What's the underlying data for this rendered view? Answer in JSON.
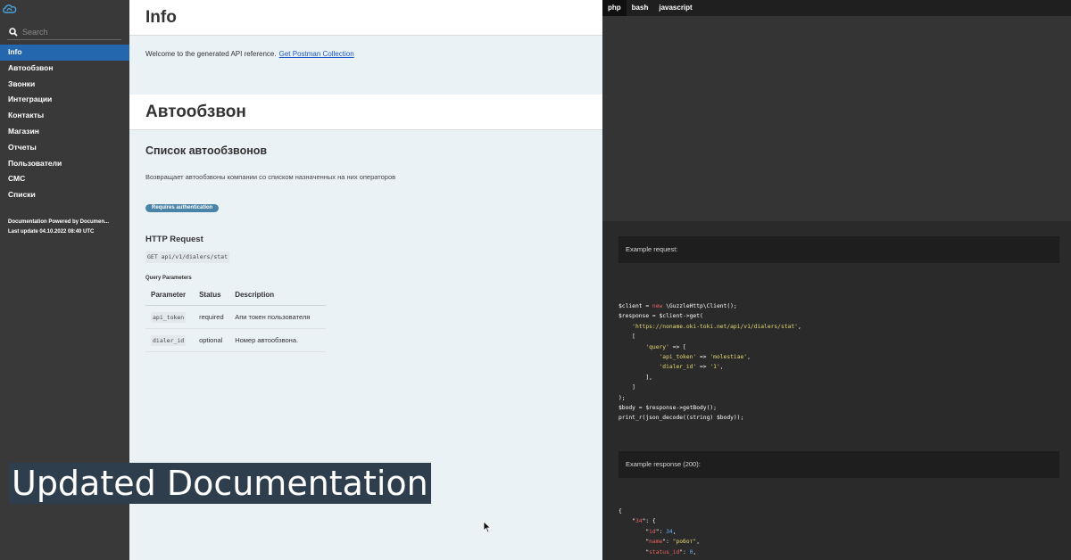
{
  "sidebar": {
    "search_placeholder": "Search",
    "items": [
      {
        "label": "Info",
        "active": true
      },
      {
        "label": "Автообзвон"
      },
      {
        "label": "Звонки"
      },
      {
        "label": "Интеграции"
      },
      {
        "label": "Контакты"
      },
      {
        "label": "Магазин"
      },
      {
        "label": "Отчеты"
      },
      {
        "label": "Пользователи"
      },
      {
        "label": "СМС"
      },
      {
        "label": "Списки"
      }
    ],
    "footer_powered": "Documentation Powered by Documen...",
    "footer_updated": "Last update 04.10.2022 08:40 UTC"
  },
  "main": {
    "info_title": "Info",
    "welcome_text": "Welcome to the generated API reference.",
    "postman_link": "Get Postman Collection",
    "section_title": "Автообзвон",
    "endpoint_title": "Список автообзвонов",
    "endpoint_desc": "Возвращает автообзвоны компании со списком назначенных на них операторов",
    "auth_badge": "Requires authentication",
    "http_request_title": "HTTP Request",
    "http_request": "GET api/v1/dialers/stat",
    "query_params_title": "Query Parameters",
    "params_headers": [
      "Parameter",
      "Status",
      "Description"
    ],
    "params": [
      {
        "name": "api_token",
        "status": "required",
        "description": "Апи токен пользователя"
      },
      {
        "name": "dialer_id",
        "status": "optional",
        "description": "Номер автообзвона."
      }
    ]
  },
  "code_panel": {
    "tabs": [
      "php",
      "bash",
      "javascript"
    ],
    "active_tab": "php",
    "example_request_label": "Example request:",
    "example_response_label": "Example response (200):"
  },
  "caption": "Updated Documentation",
  "colors": {
    "sidebar_bg": "#393939",
    "active_item": "#2467af",
    "badge": "#4a83a8",
    "code_bg": "#2d2d2d"
  }
}
